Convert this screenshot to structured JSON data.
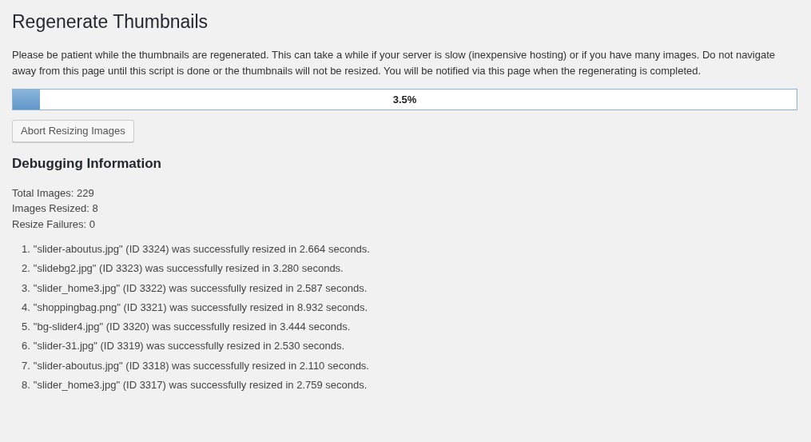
{
  "title": "Regenerate Thumbnails",
  "intro": "Please be patient while the thumbnails are regenerated. This can take a while if your server is slow (inexpensive hosting) or if you have many images. Do not navigate away from this page until this script is done or the thumbnails will not be resized. You will be notified via this page when the regenerating is completed.",
  "progress": {
    "level": 0.035,
    "label": "3.5%"
  },
  "abort_button": "Abort Resizing Images",
  "debug": {
    "heading": "Debugging Information",
    "stats": [
      "Total Images: 229",
      "Images Resized: 8",
      "Resize Failures: 0"
    ],
    "log": [
      {
        "number": "1.",
        "text": "\"slider-aboutus.jpg\" (ID 3324) was successfully resized in 2.664 seconds."
      },
      {
        "number": "2.",
        "text": "\"slidebg2.jpg\" (ID 3323) was successfully resized in 3.280 seconds."
      },
      {
        "number": "3.",
        "text": "\"slider_home3.jpg\" (ID 3322) was successfully resized in 2.587 seconds."
      },
      {
        "number": "4.",
        "text": "\"shoppingbag.png\" (ID 3321) was successfully resized in 8.932 seconds."
      },
      {
        "number": "5.",
        "text": "\"bg-slider4.jpg\" (ID 3320) was successfully resized in 3.444 seconds."
      },
      {
        "number": "6.",
        "text": "\"slider-31.jpg\" (ID 3319) was successfully resized in 2.530 seconds."
      },
      {
        "number": "7.",
        "text": "\"slider-aboutus.jpg\" (ID 3318) was successfully resized in 2.110 seconds."
      },
      {
        "number": "8.",
        "text": "\"slider_home3.jpg\" (ID 3317) was successfully resized in 2.759 seconds."
      }
    ]
  }
}
